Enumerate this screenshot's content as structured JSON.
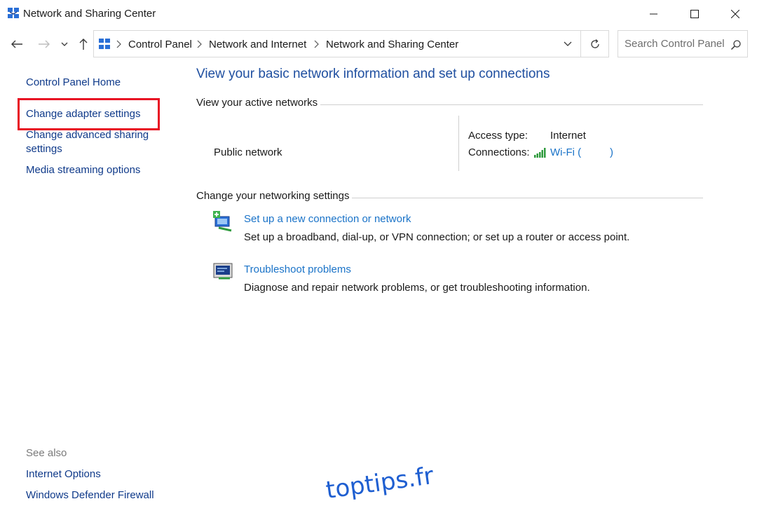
{
  "window": {
    "title": "Network and Sharing Center",
    "icon": "network-center-icon"
  },
  "address": {
    "crumbs": [
      "Control Panel",
      "Network and Internet",
      "Network and Sharing Center"
    ],
    "search_placeholder": "Search Control Panel"
  },
  "sidebar": {
    "home": "Control Panel Home",
    "items": [
      "Change adapter settings",
      "Change advanced sharing",
      "settings",
      "Media streaming options"
    ],
    "see_also_label": "See also",
    "see_also": [
      "Internet Options",
      "Windows Defender Firewall"
    ]
  },
  "main": {
    "title": "View your basic network information and set up connections",
    "active_networks_heading": "View your active networks",
    "network_name": "Public network",
    "access_type_label": "Access type:",
    "access_type_value": "Internet",
    "connections_label": "Connections:",
    "connection_value": "Wi-Fi (",
    "connection_value_end": ")",
    "networking_heading": "Change your networking settings",
    "tasks": [
      {
        "title": "Set up a new connection or network",
        "desc": "Set up a broadband, dial-up, or VPN connection; or set up a router or access point."
      },
      {
        "title": "Troubleshoot problems",
        "desc": "Diagnose and repair network problems, or get troubleshooting information."
      }
    ]
  },
  "watermark": "toptips.fr",
  "colors": {
    "link": "#0f3a8a",
    "accent_link": "#1a73c8",
    "title": "#1f4fa0",
    "highlight": "#e81123",
    "watermark": "#1f5fd1"
  }
}
